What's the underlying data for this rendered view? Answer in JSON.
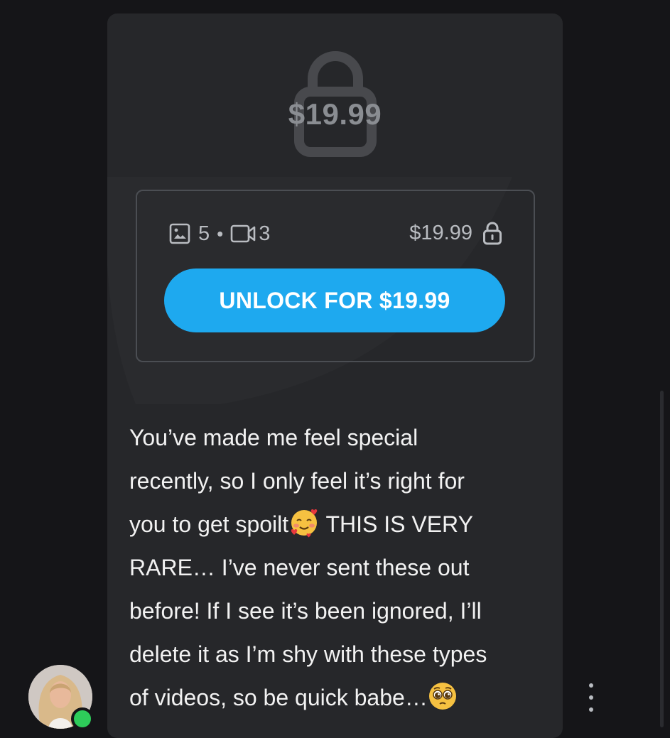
{
  "post": {
    "hero_price": "$19.99",
    "media": {
      "photo_count": "5",
      "separator": "•",
      "video_count": "3",
      "price": "$19.99"
    },
    "unlock_label": "UNLOCK FOR $19.99",
    "message_lines": [
      "You’ve made me feel special",
      "recently, so I only feel it’s right for",
      "you to get spoilt",
      " THIS IS VERY",
      "RARE… I’ve never sent these out",
      "before! If I see it’s been ignored, I’ll",
      "delete it as I’m shy with these types",
      "of videos, so be quick babe…"
    ]
  },
  "icons": {
    "hero": "lock-icon",
    "photo": "image-icon",
    "video": "video-camera-icon",
    "price_lock": "lock-icon",
    "emoji_1": "smiling-face-with-hearts",
    "emoji_2": "pleading-face",
    "more": "vertical-ellipsis-icon"
  },
  "colors": {
    "background": "#151518",
    "card": "#26272a",
    "accent": "#1ea9ef",
    "online": "#2ecc5a"
  }
}
